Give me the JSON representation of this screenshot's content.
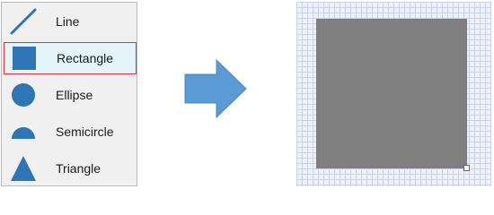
{
  "shape_menu": {
    "items": [
      {
        "label": "Line",
        "icon": "line-icon"
      },
      {
        "label": "Rectangle",
        "icon": "rectangle-icon",
        "selected": true
      },
      {
        "label": "Ellipse",
        "icon": "ellipse-icon"
      },
      {
        "label": "Semicircle",
        "icon": "semicircle-icon"
      },
      {
        "label": "Triangle",
        "icon": "triangle-icon"
      }
    ]
  },
  "colors": {
    "icon_blue": "#2e75b6",
    "selection_border": "#e0303a",
    "shape_fill": "#808080",
    "arrow_fill": "#5b9bd5"
  }
}
